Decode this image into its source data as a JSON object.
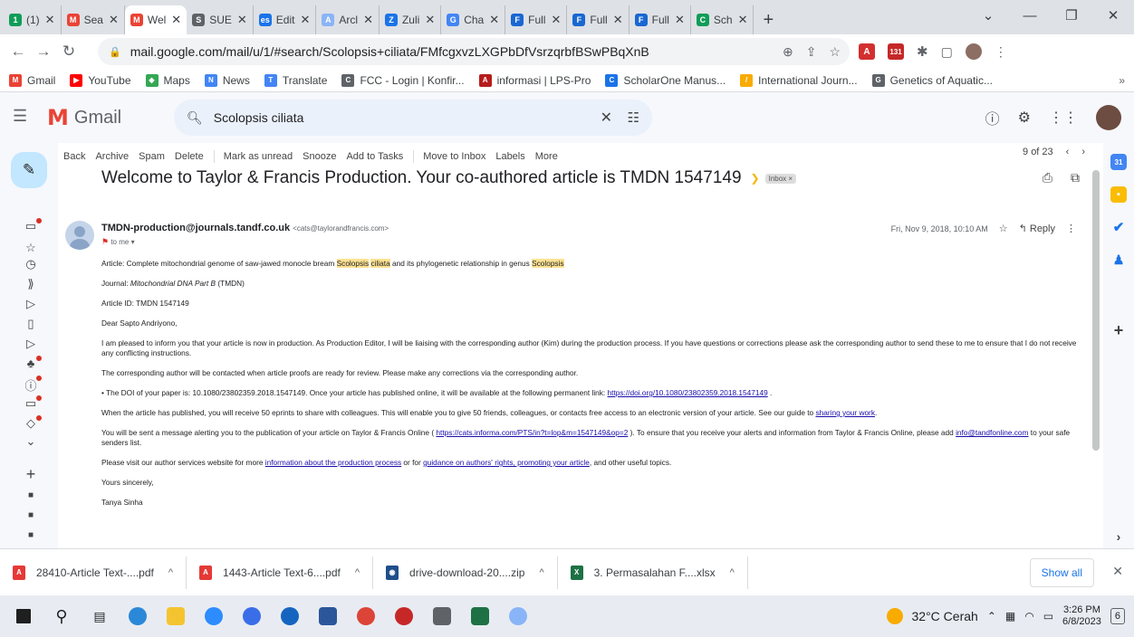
{
  "browser": {
    "tabs": [
      {
        "title": "(1)",
        "color": "#0f9d58",
        "glyph": "1"
      },
      {
        "title": "Sea",
        "color": "#ea4335",
        "glyph": "M"
      },
      {
        "title": "Wel",
        "color": "#ea4335",
        "glyph": "M",
        "active": true
      },
      {
        "title": "SUE",
        "color": "#5f6368",
        "glyph": "S"
      },
      {
        "title": "Edit",
        "color": "#1a73e8",
        "glyph": "es"
      },
      {
        "title": "Arcl",
        "color": "#8ab4f8",
        "glyph": "A"
      },
      {
        "title": "Zuli",
        "color": "#1a73e8",
        "glyph": "Z"
      },
      {
        "title": "Cha",
        "color": "#4285f4",
        "glyph": "G"
      },
      {
        "title": "Full",
        "color": "#1967d2",
        "glyph": "F"
      },
      {
        "title": "Full",
        "color": "#1967d2",
        "glyph": "F"
      },
      {
        "title": "Full",
        "color": "#1967d2",
        "glyph": "F"
      },
      {
        "title": "Sch",
        "color": "#0f9d58",
        "glyph": "C"
      }
    ],
    "url": "mail.google.com/mail/u/1/#search/Scolopsis+ciliata/FMfcgxvzLXGPbDfVsrzqrbfBSwPBqXnB",
    "bookmarks": [
      {
        "label": "Gmail",
        "color": "#ea4335",
        "glyph": "M"
      },
      {
        "label": "YouTube",
        "color": "#ff0000",
        "glyph": "▶"
      },
      {
        "label": "Maps",
        "color": "#34a853",
        "glyph": "◆"
      },
      {
        "label": "News",
        "color": "#4285f4",
        "glyph": "N"
      },
      {
        "label": "Translate",
        "color": "#4285f4",
        "glyph": "T"
      },
      {
        "label": "FCC - Login | Konfir...",
        "color": "#5f6368",
        "glyph": "C"
      },
      {
        "label": "informasi | LPS-Pro",
        "color": "#b71c1c",
        "glyph": "A"
      },
      {
        "label": "ScholarOne Manus...",
        "color": "#1a73e8",
        "glyph": "C"
      },
      {
        "label": "International Journ...",
        "color": "#f9ab00",
        "glyph": "/"
      },
      {
        "label": "Genetics of Aquatic...",
        "color": "#5f6368",
        "glyph": "G"
      }
    ]
  },
  "gmail": {
    "brand": "Gmail",
    "search_value": "Scolopsis ciliata",
    "toolbar": [
      "Back",
      "Archive",
      "Spam",
      "Delete",
      "Mark as unread",
      "Snooze",
      "Add to Tasks",
      "Move to Inbox",
      "Labels",
      "More"
    ],
    "pager": "9 of 23",
    "subject": "Welcome to Taylor & Francis Production. Your co-authored article is TMDN 1547149",
    "label": "Inbox ×",
    "sender_name": "TMDN-production@journals.tandf.co.uk",
    "sender_email": "<cats@taylorandfrancis.com>",
    "to": "to me",
    "date": "Fri, Nov 9, 2018, 10:10 AM",
    "reply": "Reply",
    "body": {
      "p1a": "Article: Complete mitochondrial genome of saw-jawed monocle bream ",
      "p1h1": "Scolopsis",
      "p1h2": "ciliata",
      "p1b": " and its phylogenetic relationship in genus ",
      "p1h3": "Scolopsis",
      "p2a": "Journal: ",
      "p2i": "Mitochondrial DNA Part B",
      "p2b": " (TMDN)",
      "p3": "Article ID: TMDN 1547149",
      "p4": "Dear Sapto Andriyono,",
      "p5": "I am pleased to inform you that your article is now in production. As Production Editor, I will be liaising with the corresponding author (Kim) during the production process. If you have questions or corrections please ask the corresponding author to send these to me to ensure that I do not receive any conflicting instructions.",
      "p6": "The corresponding author will be contacted when article proofs are ready for review. Please make any corrections via the corresponding author.",
      "p7a": "• The DOI of your paper is: 10.1080/23802359.2018.1547149. Once your article has published online, it will be available at the following permanent link: ",
      "p7link": "https://doi.org/10.1080/23802359.2018.1547149",
      "p7b": " .",
      "p8a": "When the article has published, you will receive 50 eprints to share with colleagues. This will enable you to give 50 friends, colleagues, or contacts free access to an electronic version of your article. See our guide to ",
      "p8link": "sharing your work",
      "p8b": ".",
      "p9a": "You will be sent a message alerting you to the publication of your article on Taylor & Francis Online ( ",
      "p9link": "https://cats.informa.com/PTS/in?t=lop&m=1547149&op=2",
      "p9b": " ). To ensure that you receive your alerts and information from Taylor & Francis Online, please add ",
      "p9link2": "info@tandfonline.com",
      "p9c": " to your safe senders list.",
      "p10a": "Please visit our author services website for more ",
      "p10link": "information about the production process",
      "p10b": " or for ",
      "p10link2": "guidance on authors' rights, promoting your article",
      "p10c": ", and other useful topics.",
      "p11": "Yours sincerely,",
      "p12": "Tanya Sinha"
    }
  },
  "downloads": [
    {
      "name": "28410-Article Text-....pdf",
      "color": "#e53935",
      "glyph": "A"
    },
    {
      "name": "1443-Article Text-6....pdf",
      "color": "#e53935",
      "glyph": "A"
    },
    {
      "name": "drive-download-20....zip",
      "color": "#1e4f8a",
      "glyph": "◉"
    },
    {
      "name": "3. Permasalahan F....xlsx",
      "color": "#1e7145",
      "glyph": "X"
    }
  ],
  "show_all": "Show all",
  "taskbar": {
    "weather": "32°C  Cerah",
    "time": "3:26 PM",
    "date": "6/8/2023",
    "notif": "6"
  }
}
